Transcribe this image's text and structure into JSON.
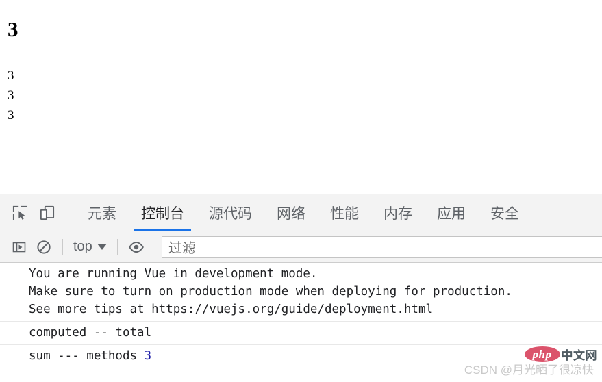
{
  "page": {
    "heading": "3",
    "lines": [
      "3",
      "3",
      "3"
    ]
  },
  "devtools": {
    "toolbar": {
      "inspect_icon": "inspect-cursor-icon",
      "device_icon": "device-toolbar-icon"
    },
    "tabs": [
      {
        "label": "元素",
        "active": false
      },
      {
        "label": "控制台",
        "active": true
      },
      {
        "label": "源代码",
        "active": false
      },
      {
        "label": "网络",
        "active": false
      },
      {
        "label": "性能",
        "active": false
      },
      {
        "label": "内存",
        "active": false
      },
      {
        "label": "应用",
        "active": false
      },
      {
        "label": "安全",
        "active": false
      }
    ],
    "console_toolbar": {
      "sidebar_icon": "console-sidebar-icon",
      "clear_icon": "clear-console-icon",
      "context_label": "top",
      "eye_icon": "live-expression-eye-icon",
      "filter_placeholder": "过滤"
    },
    "console_messages": [
      {
        "lines": [
          {
            "text": "You are running Vue in development mode."
          },
          {
            "text": "Make sure to turn on production mode when deploying for production."
          },
          {
            "text": "See more tips at ",
            "link": "https://vuejs.org/guide/deployment.html"
          }
        ]
      },
      {
        "lines": [
          {
            "text": "computed -- total"
          }
        ]
      },
      {
        "lines": [
          {
            "text": "sum --- methods ",
            "number": "3"
          }
        ]
      }
    ]
  },
  "watermarks": {
    "csdn": "CSDN @月光晒了很凉快",
    "php_logo": "php",
    "php_zh": "中文网"
  },
  "colors": {
    "accent": "#1a73e8",
    "tab_inactive": "#5f6368",
    "tab_active": "#202124",
    "panel_bg": "#f3f3f3",
    "number_literal": "#1a1aa6",
    "php_red": "#d9455f"
  }
}
